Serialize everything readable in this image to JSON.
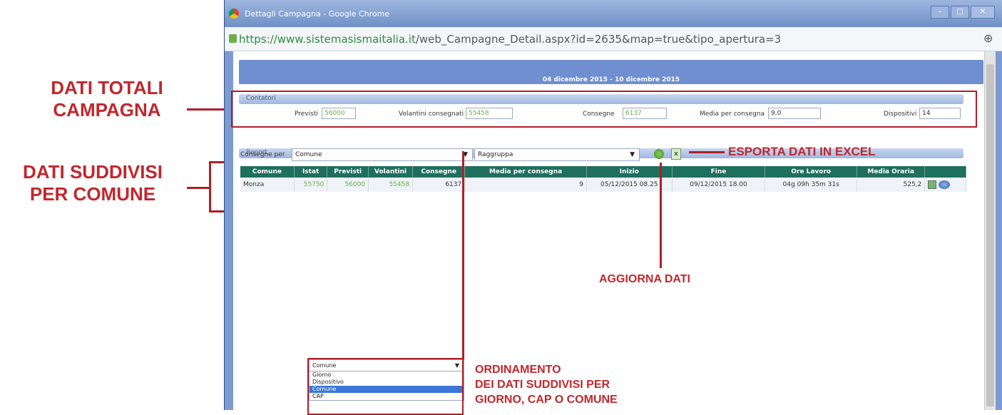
{
  "window": {
    "title": "Dettagli Campagna - Google Chrome",
    "url_domain": "https://www.sistemasismaitalia.it",
    "url_path": "/web_Campagne_Detail.aspx?id=2635&map=true&tipo_apertura=3"
  },
  "header": {
    "period": "04 dicembre 2015 - 10 dicembre 2015"
  },
  "contatori": {
    "section_title": "Contatori",
    "previsti_label": "Previsti",
    "previsti_value": "56000",
    "volantini_label": "Volantini consegnati",
    "volantini_value": "55458",
    "consegne_label": "Consegne",
    "consegne_value": "6137",
    "media_label": "Media per consegna",
    "media_value": "9,0",
    "dispositivi_label": "Dispositivi",
    "dispositivi_value": "14"
  },
  "report": {
    "section_title": "Report",
    "consegne_per_label": "Consegne per",
    "consegne_per_value": "Comune",
    "raggruppa_value": "Raggruppa"
  },
  "table": {
    "headers": [
      "Comune",
      "Istat",
      "Previsti",
      "Volantini",
      "Consegne",
      "Media per consegna",
      "Inizio",
      "Fine",
      "Ore Lavoro",
      "Media Oraria"
    ],
    "rows": [
      [
        "Monza",
        "55750",
        "56000",
        "55458",
        "6137",
        "9",
        "05/12/2015 08.25",
        "09/12/2015 18.00",
        "04g 09h 35m 31s",
        "525,2"
      ]
    ]
  },
  "dropdown": {
    "selected": "Comune",
    "options": [
      "Giorno",
      "Dispositivo",
      "Comune",
      "CAP"
    ]
  },
  "annotations": {
    "totali_line1": "DATI TOTALI",
    "totali_line2": "CAMPAGNA",
    "suddivisi_line1": "DATI SUDDIVISI",
    "suddivisi_line2": "PER COMUNE",
    "esporta": "ESPORTA DATI IN EXCEL",
    "aggiorna": "AGGIORNA DATI",
    "ordinamento_line1": "ORDINAMENTO",
    "ordinamento_line2": "DEI DATI SUDDIVISI PER",
    "ordinamento_line3": "GIORNO, CAP O COMUNE"
  },
  "colors": {
    "accent_red": "#c1272d",
    "table_header": "#1f6f5e",
    "window_blue": "#7d9bd0"
  }
}
